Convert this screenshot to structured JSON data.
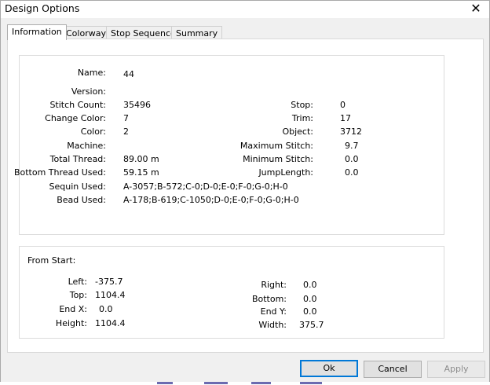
{
  "dialog": {
    "title": "Design Options",
    "close_glyph": "✕"
  },
  "tabs": [
    "Information",
    "Colorway",
    "Stop Sequence",
    "Summary"
  ],
  "info": {
    "name": {
      "label": "Name:",
      "value": "44"
    },
    "version": {
      "label": "Version:",
      "value": ""
    },
    "stitch_count": {
      "label": "Stitch Count:",
      "value": "35496"
    },
    "change_color": {
      "label": "Change Color:",
      "value": "7"
    },
    "color": {
      "label": "Color:",
      "value": "2"
    },
    "machine": {
      "label": "Machine:",
      "value": ""
    },
    "total_thread": {
      "label": "Total Thread:",
      "value": "89.00 m"
    },
    "bottom_thread": {
      "label": "Bottom Thread Used:",
      "value": "59.15 m"
    },
    "sequin_used": {
      "label": "Sequin Used:",
      "value": "A-3057;B-572;C-0;D-0;E-0;F-0;G-0;H-0"
    },
    "bead_used": {
      "label": "Bead Used:",
      "value": "A-178;B-619;C-1050;D-0;E-0;F-0;G-0;H-0"
    },
    "stop": {
      "label": "Stop:",
      "value": "0"
    },
    "trim": {
      "label": "Trim:",
      "value": "17"
    },
    "object": {
      "label": "Object:",
      "value": "3712"
    },
    "max_stitch": {
      "label": "Maximum Stitch:",
      "value": "9.7"
    },
    "min_stitch": {
      "label": "Minimum Stitch:",
      "value": "0.0"
    },
    "jump_length": {
      "label": "JumpLength:",
      "value": "0.0"
    }
  },
  "from_start": {
    "heading": "From Start:",
    "left": {
      "label": "Left:",
      "value": "-375.7"
    },
    "top": {
      "label": "Top:",
      "value": "1104.4"
    },
    "end_x": {
      "label": "End X:",
      "value": "0.0"
    },
    "height": {
      "label": "Height:",
      "value": "1104.4"
    },
    "right": {
      "label": "Right:",
      "value": "0.0"
    },
    "bottom": {
      "label": "Bottom:",
      "value": "0.0"
    },
    "end_y": {
      "label": "End Y:",
      "value": "0.0"
    },
    "width": {
      "label": "Width:",
      "value": "375.7"
    }
  },
  "buttons": {
    "ok": "Ok",
    "cancel": "Cancel",
    "apply": "Apply"
  },
  "colors": {
    "accent": "#0078d7"
  }
}
